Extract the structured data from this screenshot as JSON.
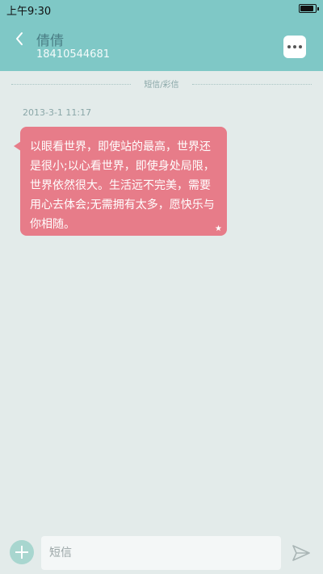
{
  "status_bar": {
    "time": "上午9:30",
    "battery_level": 0.9
  },
  "header": {
    "contact_name": "倩倩",
    "contact_number": "18410544681"
  },
  "divider": {
    "label": "短信/彩信"
  },
  "message": {
    "timestamp": "2013-3-1 11:17",
    "text": "以眼看世界，即使站的最高，世界还是很小;以心看世界，即使身处局限，世界依然很大。生活远不完美，需要用心去体会;无需拥有太多，愿快乐与你相随。",
    "starred": true
  },
  "input": {
    "placeholder": "短信"
  },
  "icons": {
    "back": "chevron-left-icon",
    "more": "more-dots-icon",
    "star": "star-icon",
    "add": "plus-icon",
    "send": "send-icon"
  },
  "colors": {
    "header_bg": "#7fc8c6",
    "page_bg": "#e3ebea",
    "bubble_bg": "#e77c89",
    "contact_name": "#4b7f86"
  }
}
